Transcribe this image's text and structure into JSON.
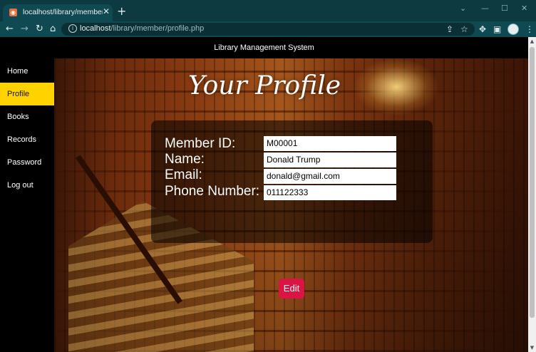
{
  "browser": {
    "tab_title": "localhost/library/member/profile.php",
    "tab_close": "✕",
    "new_tab": "+",
    "url_host": "localhost",
    "url_path": "/library/member/profile.php",
    "back": "←",
    "forward": "→",
    "reload": "↻",
    "home": "⌂",
    "minimize": "—",
    "maximize": "☐",
    "close": "✕",
    "more": "⋮"
  },
  "header": {
    "title": "Library Management System"
  },
  "sidebar": {
    "items": [
      {
        "label": "Home"
      },
      {
        "label": "Profile"
      },
      {
        "label": "Books"
      },
      {
        "label": "Records"
      },
      {
        "label": "Password"
      },
      {
        "label": "Log out"
      }
    ],
    "active_color": "#ffd200"
  },
  "main": {
    "title": "Your Profile",
    "fields": [
      {
        "label": "Member ID:",
        "value": "M00001"
      },
      {
        "label": "Name:",
        "value": "Donald Trump"
      },
      {
        "label": "Email:",
        "value": "donald@gmail.com"
      },
      {
        "label": "Phone Number:",
        "value": "011122333"
      }
    ],
    "edit_label": "Edit",
    "edit_color": "#dc1444"
  }
}
